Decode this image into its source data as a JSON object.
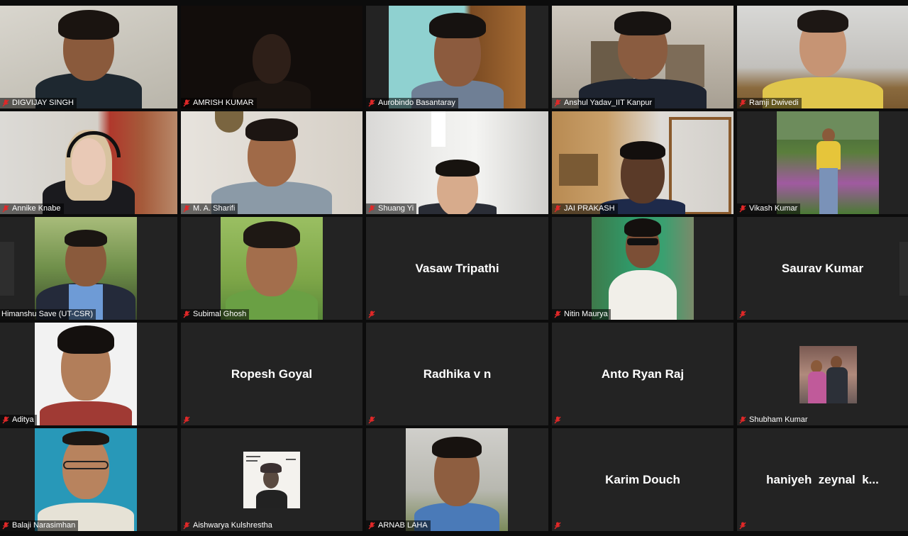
{
  "participants": [
    {
      "name": "DIGVIJAY SINGH"
    },
    {
      "name": "AMRISH KUMAR"
    },
    {
      "name": "Aurobindo Basantaray"
    },
    {
      "name": "Anshul Yadav_IIT Kanpur"
    },
    {
      "name": "Ramji Dwivedi"
    },
    {
      "name": "Annike Knabe"
    },
    {
      "name": "M. A. Sharifi"
    },
    {
      "name": "Shuang Yi"
    },
    {
      "name": "JAI PRAKASH"
    },
    {
      "name": "Vikash Kumar"
    },
    {
      "name": "Himanshu Save (UT-CSR)"
    },
    {
      "name": "Subimal Ghosh"
    },
    {
      "name": "Vasaw Tripathi"
    },
    {
      "name": "Nitin Maurya"
    },
    {
      "name": "Saurav Kumar"
    },
    {
      "name": "Aditya"
    },
    {
      "name": "Ropesh Goyal"
    },
    {
      "name": "Radhika v n"
    },
    {
      "name": "Anto Ryan Raj"
    },
    {
      "name": "Shubham Kumar"
    },
    {
      "name": "Balaji Narasimhan"
    },
    {
      "name": "Aishwarya Kulshrestha"
    },
    {
      "name": "ARNAB LAHA"
    },
    {
      "name": "Karim Douch"
    },
    {
      "name": "haniyeh  zeynal  k..."
    }
  ],
  "colors": {
    "background": "#0c0c0c",
    "tile": "#232323",
    "mute_icon": "#e02828",
    "name_text": "#ffffff"
  },
  "icons": {
    "mute": "microphone-muted-icon"
  }
}
